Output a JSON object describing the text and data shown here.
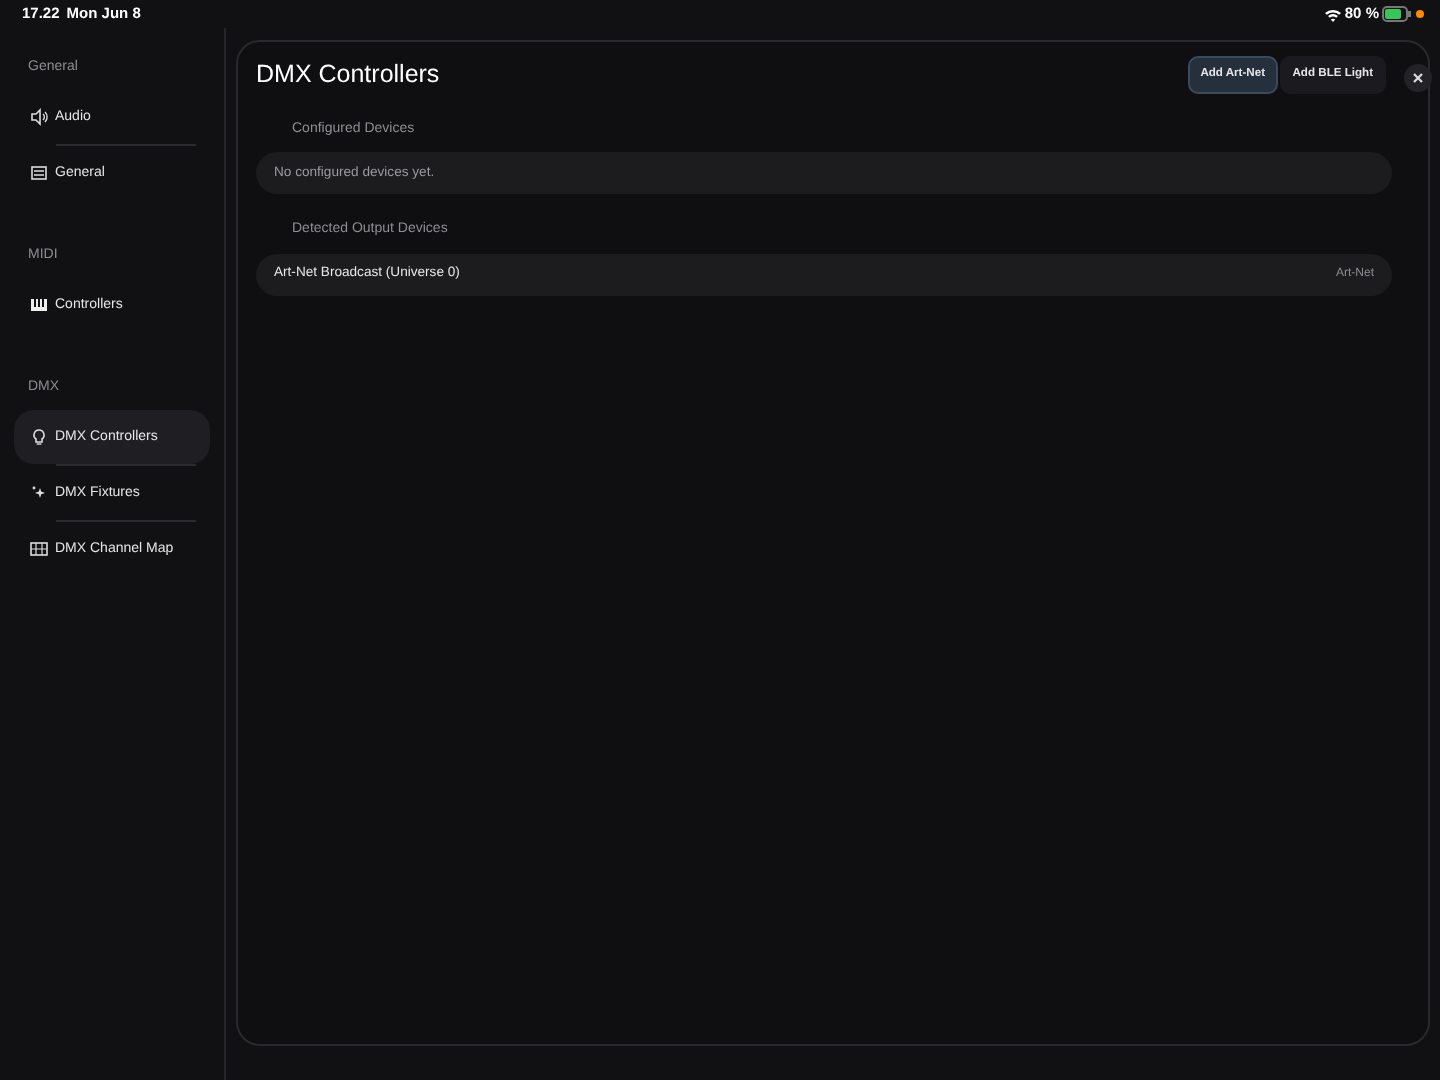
{
  "status_bar": {
    "time": "17.22",
    "date": "Mon Jun 8",
    "battery": "80 %"
  },
  "sidebar": {
    "sections": [
      {
        "title": "General",
        "items": [
          {
            "label": "Audio",
            "selected": false
          },
          {
            "label": "General",
            "selected": false
          }
        ]
      },
      {
        "title": "MIDI",
        "items": [
          {
            "label": "Controllers",
            "selected": false
          }
        ]
      },
      {
        "title": "DMX",
        "items": [
          {
            "label": "DMX Controllers",
            "selected": true
          },
          {
            "label": "DMX Fixtures",
            "selected": false
          },
          {
            "label": "DMX Channel Map",
            "selected": false
          }
        ]
      }
    ]
  },
  "panel": {
    "title": "DMX Controllers",
    "buttons": [
      {
        "label": "Add Art-Net",
        "kind": "primary"
      },
      {
        "label": "Add BLE Light",
        "kind": "secondary"
      }
    ],
    "sections": [
      {
        "title": "Configured Devices",
        "rows": [
          {
            "kind": "empty",
            "label": "No configured devices yet."
          }
        ]
      },
      {
        "title": "Detected Output Devices",
        "rows": [
          {
            "kind": "device",
            "label": "Art-Net Broadcast (Universe 0)",
            "detail": "Art-Net"
          }
        ]
      }
    ]
  }
}
